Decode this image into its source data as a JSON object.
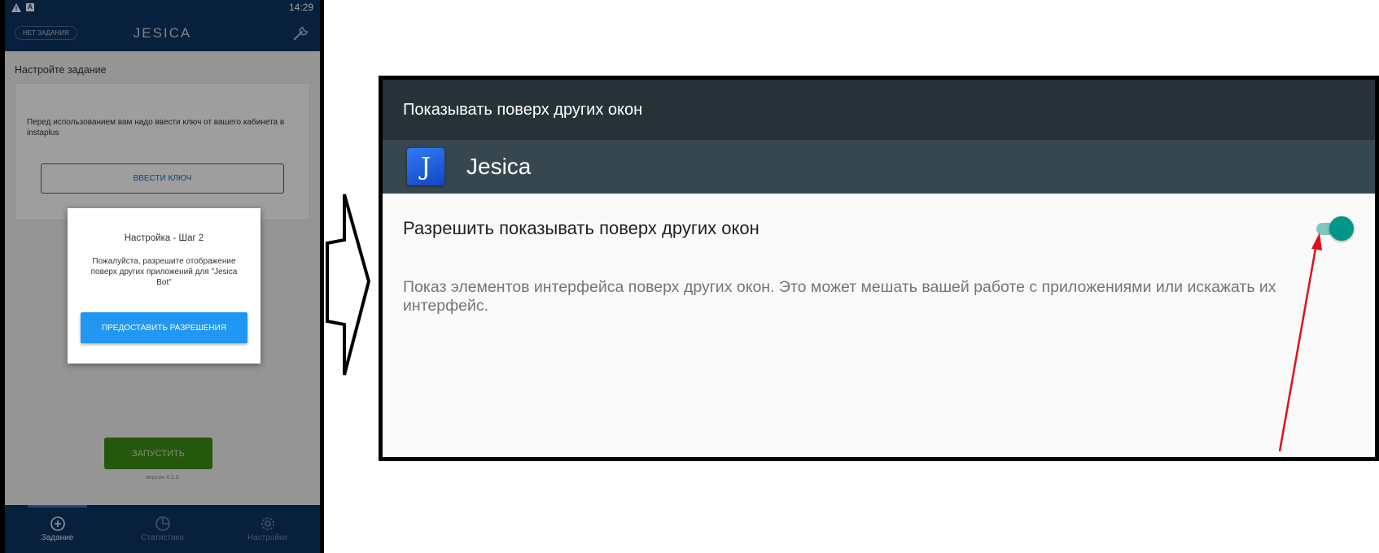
{
  "phone": {
    "status_time": "14:29",
    "status_icons": [
      "warning-icon",
      "a-notification-icon"
    ],
    "task_chip": "НЕТ ЗАДАНИЯ",
    "app_title": "JESICA",
    "section_title": "Настройте задание",
    "card_text": "Перед использованием вам надо ввести ключ от вашего кабинета в instaplus",
    "key_button": "ВВЕСТИ КЛЮЧ",
    "launch_button": "ЗАПУСТИТЬ",
    "version": "версия 4.2.3",
    "nav": [
      {
        "label": "Задание",
        "icon": "add-circle-icon",
        "active": true
      },
      {
        "label": "Статистика",
        "icon": "pie-chart-icon",
        "active": false
      },
      {
        "label": "Настройки",
        "icon": "gear-icon",
        "active": false
      }
    ],
    "dialog": {
      "title": "Настройка - Шаг  2",
      "text": "Пожалуйста, разрешите отображение поверх других приложений для \"Jesica Bot\"",
      "button": "ПРЕДОСТАВИТЬ РАЗРЕШЕНИЯ"
    }
  },
  "settings": {
    "header_title": "Показывать поверх других окон",
    "app_logo_letter": "J",
    "app_name": "Jesica",
    "permission_label": "Разрешить показывать поверх других окон",
    "permission_enabled": true,
    "permission_description": "Показ элементов интерфейса поверх других окон. Это может мешать вашей работе с приложениями или искажать их интерфейс."
  },
  "colors": {
    "phone_primary": "#0c3461",
    "dialog_button": "#2196f3",
    "launch_button": "#3d8e13",
    "settings_header": "#263238",
    "settings_app_row": "#37474f",
    "toggle_on": "#009688",
    "annotation_arrow": "#e0101e"
  }
}
